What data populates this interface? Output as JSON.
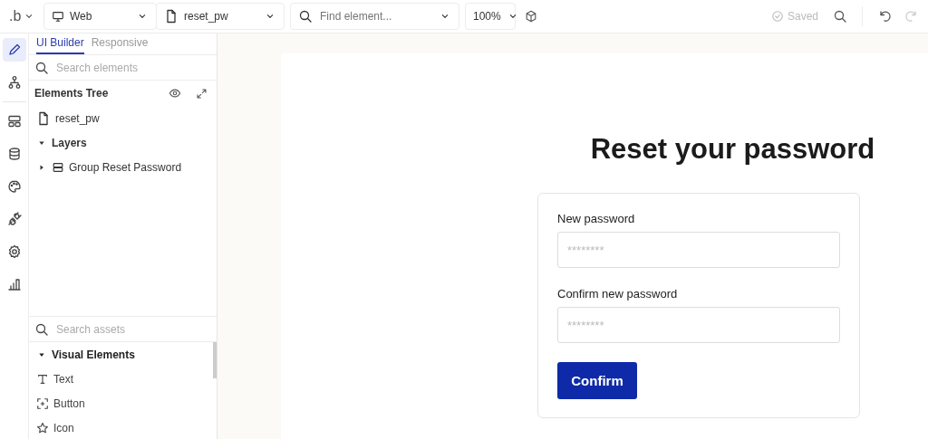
{
  "toolbar": {
    "logo": ".b",
    "platform": "Web",
    "page": "reset_pw",
    "find": {
      "placeholder": "Find element..."
    },
    "zoom": "100%",
    "status": "Saved",
    "undo": {
      "disabled": false
    },
    "redo": {
      "disabled": true
    }
  },
  "rail": [
    {
      "kind": "edit",
      "selected": true
    },
    {
      "kind": "hierarchy",
      "selected": false
    },
    {
      "kind": "layout",
      "selected": false
    },
    {
      "kind": "database",
      "selected": false
    },
    {
      "kind": "palette",
      "selected": false
    },
    {
      "kind": "plugin",
      "selected": false
    },
    {
      "kind": "settings",
      "selected": false
    },
    {
      "kind": "chart",
      "selected": false
    }
  ],
  "panel": {
    "tabs": [
      {
        "label": "UI Builder",
        "selected": true
      },
      {
        "label": "Responsive",
        "selected": false
      }
    ],
    "search": {
      "placeholder": "Search elements"
    },
    "tree_title": "Elements Tree",
    "tree_page": "reset_pw",
    "layers": {
      "label": "Layers",
      "expanded": true,
      "children": [
        {
          "label": "Group Reset Password",
          "expanded": false
        }
      ]
    },
    "assets_search": {
      "placeholder": "Search assets"
    },
    "assets": {
      "label": "Visual Elements",
      "expanded": true,
      "items": [
        {
          "label": "Text",
          "kind": "text"
        },
        {
          "label": "Button",
          "kind": "button"
        },
        {
          "label": "Icon",
          "kind": "icon"
        }
      ]
    }
  },
  "canvas": {
    "heading": "Reset your password",
    "fields": [
      {
        "label": "New password",
        "placeholder": "********"
      },
      {
        "label": "Confirm new password",
        "placeholder": "********"
      }
    ],
    "button": "Confirm"
  }
}
